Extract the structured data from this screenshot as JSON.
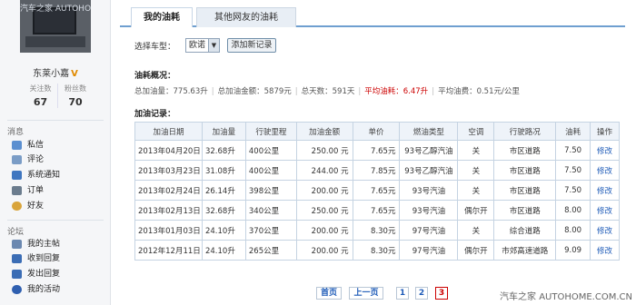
{
  "sidebar": {
    "avatar_watermark": "汽车之家 AUTOHOME",
    "username": "东莱小嘉",
    "verified_mark": "V",
    "stats": [
      {
        "label": "关注数",
        "value": "67"
      },
      {
        "label": "粉丝数",
        "value": "70"
      }
    ],
    "messages_heading": "消息",
    "messages_items": [
      {
        "label": "私信",
        "icon": "envelope-icon",
        "color": "#5b8fd0"
      },
      {
        "label": "评论",
        "icon": "comment-icon",
        "color": "#7a9cc6"
      },
      {
        "label": "系统通知",
        "icon": "speaker-icon",
        "color": "#3f76c0"
      },
      {
        "label": "订单",
        "icon": "cart-icon",
        "color": "#6b7c8e"
      },
      {
        "label": "好友",
        "icon": "friends-icon",
        "color": "#d9a43a"
      }
    ],
    "forum_heading": "论坛",
    "forum_items": [
      {
        "label": "我的主帖",
        "icon": "doc-icon",
        "color": "#6b88b0"
      },
      {
        "label": "收到回复",
        "icon": "reply-in-icon",
        "color": "#3b6db5"
      },
      {
        "label": "发出回复",
        "icon": "reply-out-icon",
        "color": "#3b6db5"
      },
      {
        "label": "我的活动",
        "icon": "heart-icon",
        "color": "#2f5fb0"
      }
    ]
  },
  "tabs": {
    "active": "我的油耗",
    "other": "其他网友的油耗"
  },
  "vehicle": {
    "label": "选择车型：",
    "selected": "欧诺",
    "add_button": "添加新记录"
  },
  "summary": {
    "title": "油耗概况：",
    "total_fuel": "总加油量：775.63升",
    "total_amount": "总加油金额：5879元",
    "total_days": "总天数：591天",
    "avg_consumption": "平均油耗：6.47升",
    "avg_cost": "平均油费：0.51元/公里"
  },
  "records": {
    "title": "加油记录：",
    "columns": [
      "加油日期",
      "加油量",
      "行驶里程",
      "加油金额",
      "单价",
      "燃油类型",
      "空调",
      "行驶路况",
      "油耗",
      "操作"
    ],
    "rows": [
      [
        "2013年04月20日",
        "32.68升",
        "400公里",
        "250.00 元",
        "7.65元",
        "93号乙醇汽油",
        "关",
        "市区道路",
        "7.50",
        "修改"
      ],
      [
        "2013年03月23日",
        "31.08升",
        "400公里",
        "244.00 元",
        "7.85元",
        "93号乙醇汽油",
        "关",
        "市区道路",
        "7.50",
        "修改"
      ],
      [
        "2013年02月24日",
        "26.14升",
        "398公里",
        "200.00 元",
        "7.65元",
        "93号汽油",
        "关",
        "市区道路",
        "7.50",
        "修改"
      ],
      [
        "2013年02月13日",
        "32.68升",
        "340公里",
        "250.00 元",
        "7.65元",
        "93号汽油",
        "偶尔开",
        "市区道路",
        "8.00",
        "修改"
      ],
      [
        "2013年01月03日",
        "24.10升",
        "370公里",
        "200.00 元",
        "8.30元",
        "97号汽油",
        "关",
        "综合道路",
        "8.00",
        "修改"
      ],
      [
        "2012年12月11日",
        "24.10升",
        "265公里",
        "200.00 元",
        "8.30元",
        "97号汽油",
        "偶尔开",
        "市郊高速道路",
        "9.09",
        "修改"
      ]
    ]
  },
  "pager": {
    "first": "首页",
    "prev": "上一页",
    "pages": [
      "1",
      "2",
      "3"
    ],
    "current": "3"
  },
  "watermark": "汽车之家 AUTOHOME.COM.CN"
}
